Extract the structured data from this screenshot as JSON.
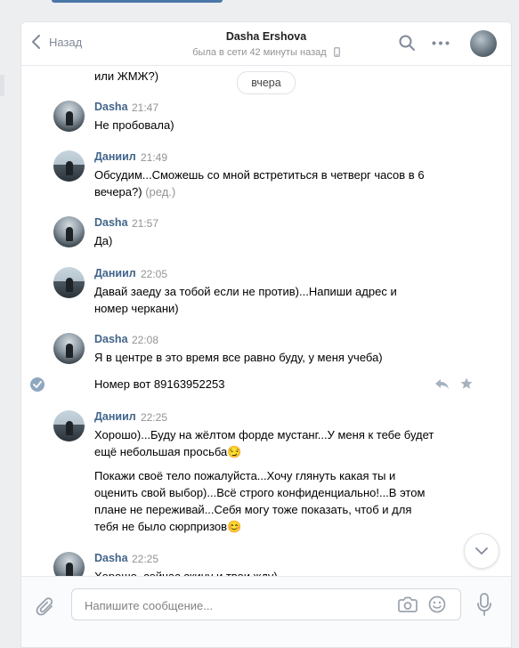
{
  "header": {
    "back_label": "Назад",
    "contact_name": "Dasha Ershova",
    "status": "была в сети 42 минуты назад"
  },
  "top_fragment": "или ЖМЖ?)",
  "date_separator": "вчера",
  "messages": [
    {
      "author": "Dasha",
      "time": "21:47",
      "lines": [
        "Не пробовала)"
      ]
    },
    {
      "author": "Даниил",
      "time": "21:49",
      "lines": [
        "Обсудим...Сможешь со мной встретиться в четверг часов в 6",
        "вечера?)"
      ],
      "edited": "(ред.)"
    },
    {
      "author": "Dasha",
      "time": "21:57",
      "lines": [
        "Да)"
      ]
    },
    {
      "author": "Даниил",
      "time": "22:05",
      "lines": [
        "Давай заеду за тобой если не против)...Напиши адрес и",
        "номер черкани)"
      ]
    },
    {
      "author": "Dasha",
      "time": "22:08",
      "lines": [
        "Я в центре в это время все равно буду, у меня учеба)"
      ],
      "extra": "Номер вот 89163952253"
    },
    {
      "author": "Даниил",
      "time": "22:25",
      "lines": [
        "Хорошо)...Буду на жёлтом форде мустанг...У меня к тебе будет",
        "ещё небольшая просьба😏"
      ],
      "extra_lines": [
        "Покажи своё тело пожалуйста...Хочу глянуть какая ты и",
        "оценить свой выбор)...Всё строго конфиденциально!...В этом",
        "плане не переживай...Себя могу тоже показать, чтоб и для",
        "тебя не было сюрпризов😊"
      ]
    },
    {
      "author": "Dasha",
      "time": "22:25",
      "lines": [
        "Хорошо, сейчас скину и твои жду)"
      ]
    }
  ],
  "composer": {
    "placeholder": "Напишите сообщение..."
  },
  "colors": {
    "accent": "#4a76a8",
    "author_name": "#42648b",
    "muted": "#939393"
  }
}
